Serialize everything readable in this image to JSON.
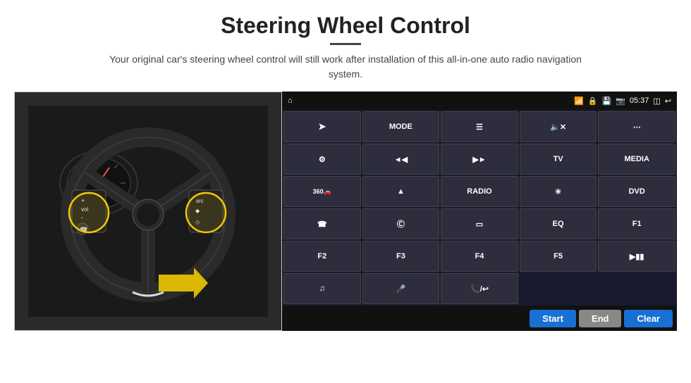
{
  "header": {
    "title": "Steering Wheel Control",
    "subtitle": "Your original car's steering wheel control will still work after installation of this all-in-one auto radio navigation system."
  },
  "statusBar": {
    "time": "05:37"
  },
  "buttons": {
    "mode": "MODE",
    "tv": "TV",
    "media": "MEDIA",
    "radio": "RADIO",
    "dvd": "DVD",
    "eq": "EQ",
    "f1": "F1",
    "f2": "F2",
    "f3": "F3",
    "f4": "F4",
    "f5": "F5"
  },
  "bottomBar": {
    "start": "Start",
    "end": "End",
    "clear": "Clear"
  }
}
